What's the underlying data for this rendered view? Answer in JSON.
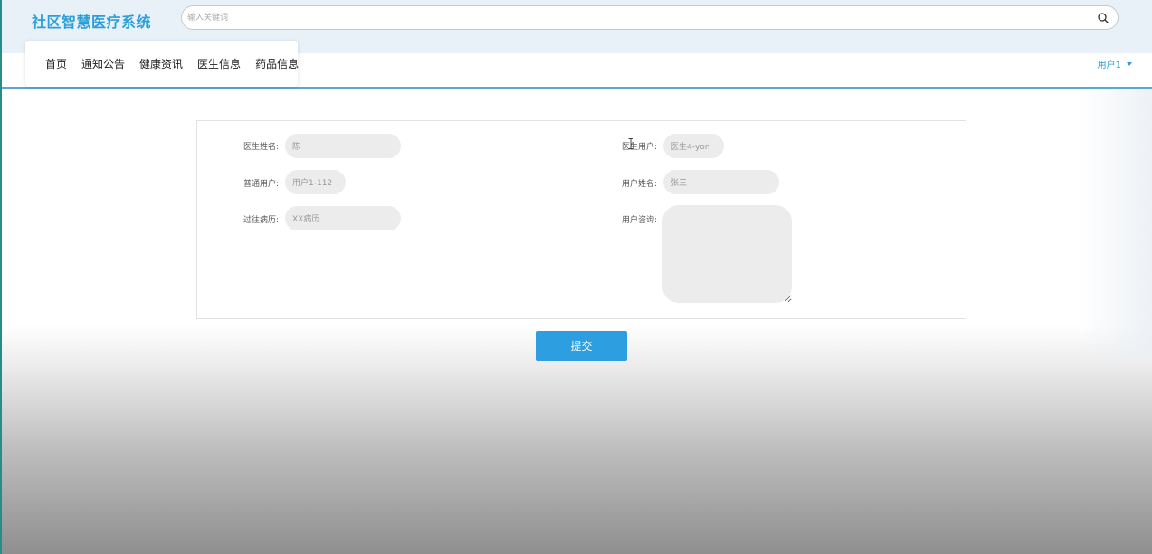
{
  "app": {
    "title": "社区智慧医疗系统"
  },
  "search": {
    "placeholder": "输入关键词",
    "icon": "search-icon"
  },
  "nav": {
    "items": [
      {
        "label": "首页"
      },
      {
        "label": "通知公告"
      },
      {
        "label": "健康资讯"
      },
      {
        "label": "医生信息"
      },
      {
        "label": "药品信息"
      }
    ]
  },
  "user_menu": {
    "label": "用户1"
  },
  "form": {
    "doctor_name": {
      "label": "医生姓名:",
      "value": "陈一"
    },
    "doctor_user": {
      "label": "医生用户:",
      "value": "医生4-yon"
    },
    "normal_user": {
      "label": "普通用户:",
      "value": "用户1-112"
    },
    "user_name": {
      "label": "用户姓名:",
      "value": "张三"
    },
    "history": {
      "label": "过往病历:",
      "value": "XX病历"
    },
    "consult": {
      "label": "用户咨询:",
      "value": ""
    },
    "submit_label": "提交"
  },
  "colors": {
    "accent": "#2d9fd6",
    "button": "#2d9fe0",
    "topbar_bg": "#e8f1f8",
    "field_bg": "#ececec",
    "nav_border": "#5aa8d8"
  }
}
